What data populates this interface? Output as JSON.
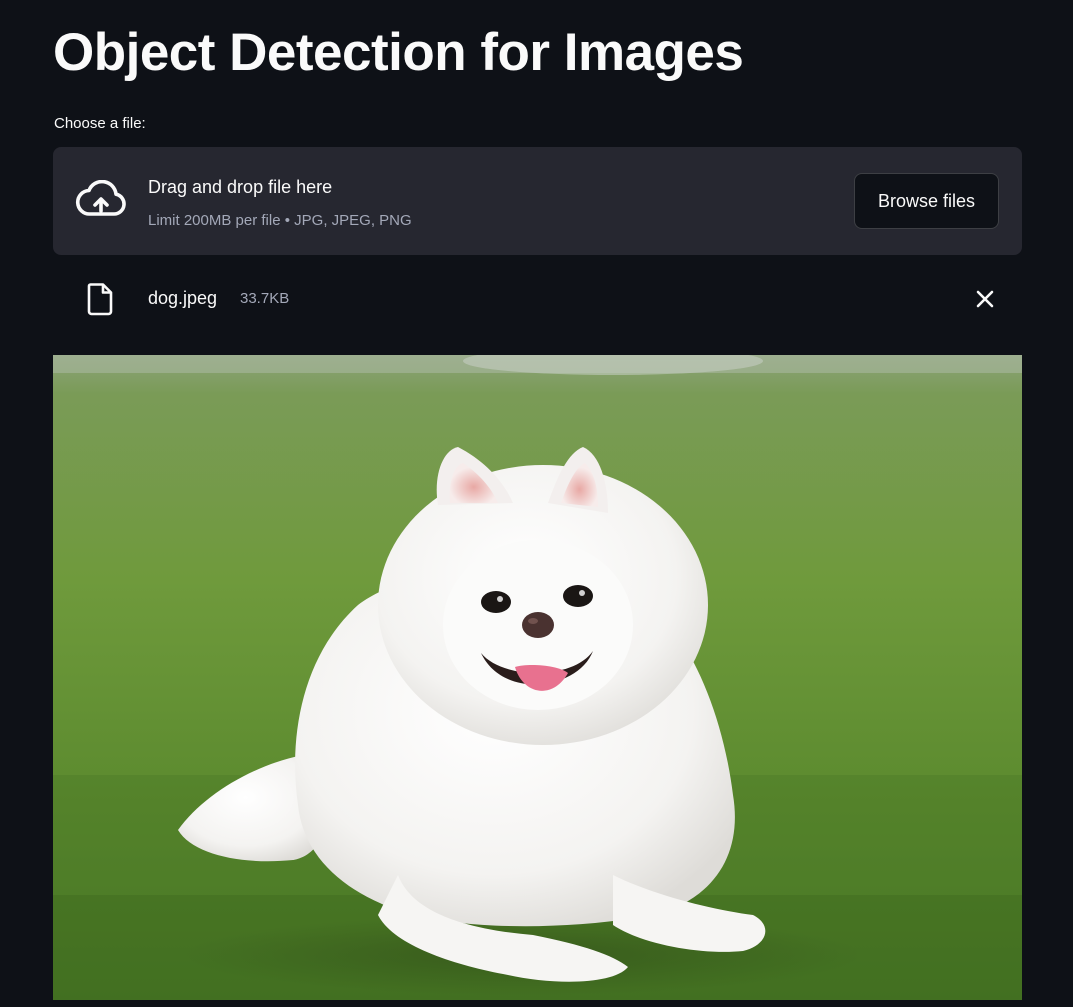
{
  "page": {
    "title": "Object Detection for Images"
  },
  "uploader": {
    "label": "Choose a file:",
    "drop_title": "Drag and drop file here",
    "drop_hint": "Limit 200MB per file • JPG, JPEG, PNG",
    "browse_label": "Browse files",
    "upload_icon": "cloud-upload-icon"
  },
  "uploaded_file": {
    "name": "dog.jpeg",
    "size": "33.7KB",
    "file_icon": "file-icon",
    "remove_icon": "close-icon"
  },
  "image": {
    "subject": "dog"
  },
  "colors": {
    "background": "#0e1117",
    "panel": "#262730",
    "text": "#fafafa",
    "muted": "#a3a8b8"
  }
}
